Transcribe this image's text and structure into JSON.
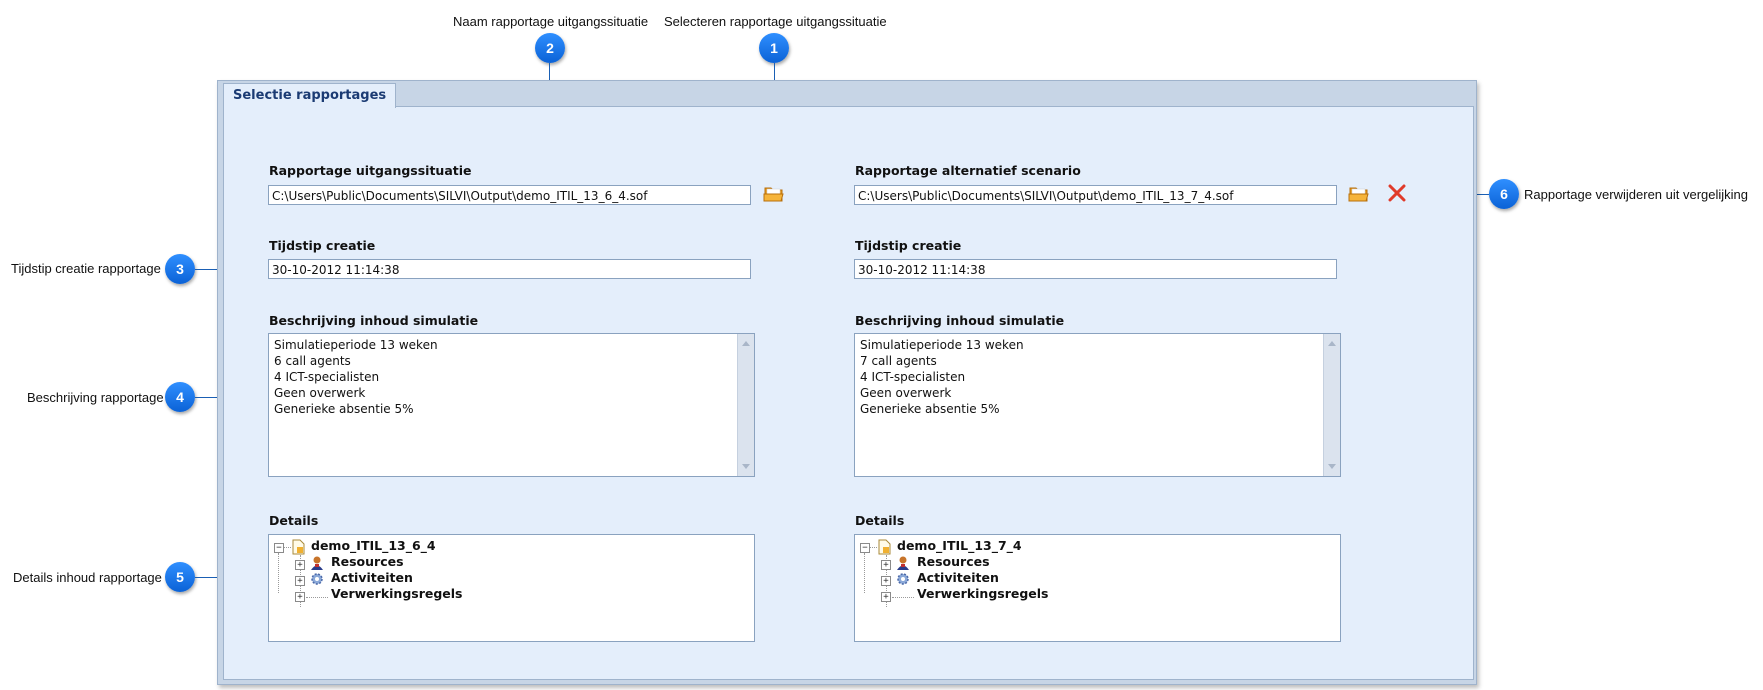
{
  "callouts": {
    "c1": {
      "number": "1",
      "label": "Selecteren rapportage uitgangssituatie"
    },
    "c2": {
      "number": "2",
      "label": "Naam rapportage uitgangssituatie"
    },
    "c3": {
      "number": "3",
      "label": "Tijdstip creatie rapportage"
    },
    "c4": {
      "number": "4",
      "label": "Beschrijving rapportage"
    },
    "c5": {
      "number": "5",
      "label": "Details inhoud rapportage"
    },
    "c6": {
      "number": "6",
      "label": "Rapportage verwijderen uit vergelijking"
    }
  },
  "tab": {
    "label": "Selectie rapportages"
  },
  "left": {
    "report_label": "Rapportage uitgangssituatie",
    "report_path": "C:\\Users\\Public\\Documents\\SILVI\\Output\\demo_ITIL_13_6_4.sof",
    "time_label": "Tijdstip creatie",
    "time_value": "30-10-2012 11:14:38",
    "desc_label": "Beschrijving inhoud simulatie",
    "desc_lines": [
      "Simulatieperiode 13 weken",
      "6 call agents",
      "4 ICT-specialisten",
      "Geen overwerk",
      "Generieke absentie 5%"
    ],
    "details_label": "Details",
    "tree_root": "demo_ITIL_13_6_4",
    "tree_children": [
      "Resources",
      "Activiteiten",
      "Verwerkingsregels"
    ]
  },
  "right": {
    "report_label": "Rapportage alternatief scenario",
    "report_path": "C:\\Users\\Public\\Documents\\SILVI\\Output\\demo_ITIL_13_7_4.sof",
    "time_label": "Tijdstip creatie",
    "time_value": "30-10-2012 11:14:38",
    "desc_label": "Beschrijving inhoud simulatie",
    "desc_lines": [
      "Simulatieperiode 13 weken",
      "7 call agents",
      "4 ICT-specialisten",
      "Geen overwerk",
      "Generieke absentie 5%"
    ],
    "details_label": "Details",
    "tree_root": "demo_ITIL_13_7_4",
    "tree_children": [
      "Resources",
      "Activiteiten",
      "Verwerkingsregels"
    ]
  },
  "icons": {
    "open_folder": "folder-open-icon",
    "delete": "red-x-icon",
    "resources": "person-icon",
    "activities": "gear-icon",
    "root": "document-icon"
  },
  "colors": {
    "badge": "#0b62d6",
    "leader_line": "#1a5fb4",
    "panel_bg": "#e4eefb",
    "delete_red": "#e03a2a"
  }
}
